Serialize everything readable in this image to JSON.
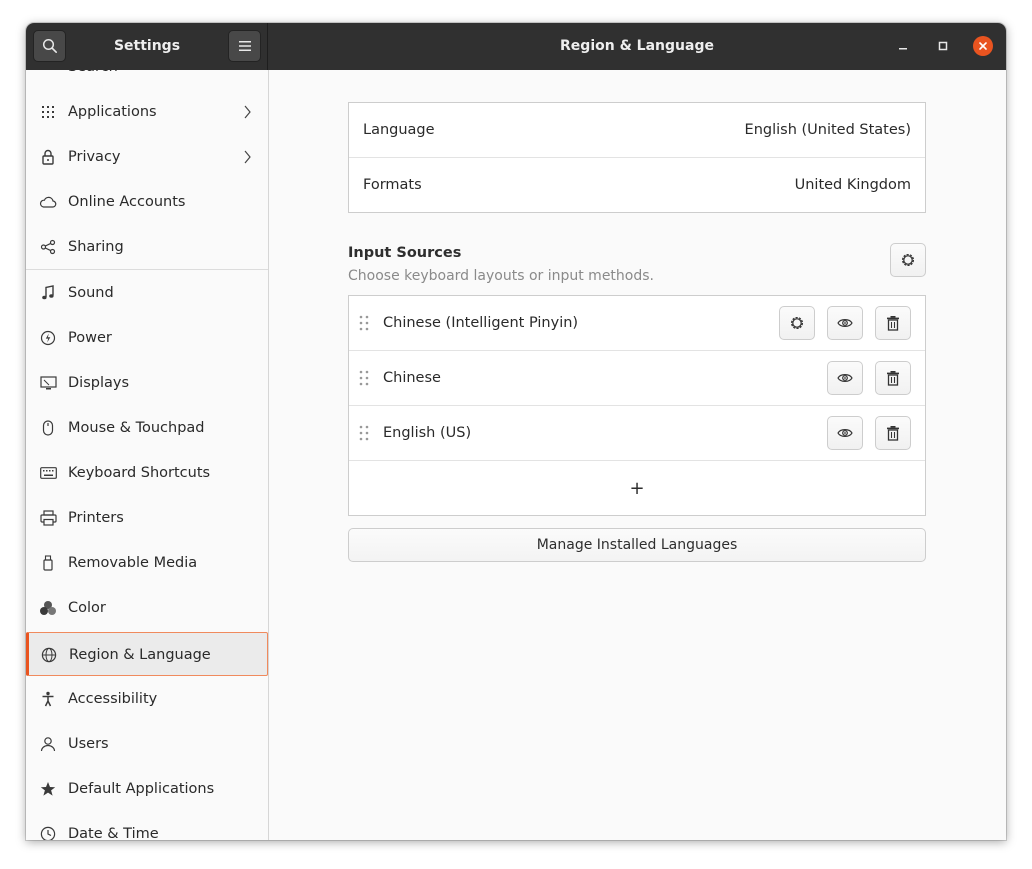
{
  "window": {
    "sidebar_title": "Settings",
    "page_title": "Region & Language"
  },
  "sidebar": {
    "partial_top_label": "Search",
    "items": [
      {
        "label": "Applications",
        "icon": "apps-grid-icon",
        "chevron": true
      },
      {
        "label": "Privacy",
        "icon": "lock-icon",
        "chevron": true
      },
      {
        "label": "Online Accounts",
        "icon": "cloud-icon",
        "chevron": false
      },
      {
        "label": "Sharing",
        "icon": "share-icon",
        "chevron": false
      },
      {
        "label": "Sound",
        "icon": "music-note-icon",
        "chevron": false
      },
      {
        "label": "Power",
        "icon": "power-icon",
        "chevron": false
      },
      {
        "label": "Displays",
        "icon": "display-icon",
        "chevron": false
      },
      {
        "label": "Mouse & Touchpad",
        "icon": "mouse-icon",
        "chevron": false
      },
      {
        "label": "Keyboard Shortcuts",
        "icon": "keyboard-icon",
        "chevron": false
      },
      {
        "label": "Printers",
        "icon": "printer-icon",
        "chevron": false
      },
      {
        "label": "Removable Media",
        "icon": "usb-drive-icon",
        "chevron": false
      },
      {
        "label": "Color",
        "icon": "color-circles-icon",
        "chevron": false
      },
      {
        "label": "Region & Language",
        "icon": "globe-icon",
        "chevron": false,
        "selected": true
      },
      {
        "label": "Accessibility",
        "icon": "accessibility-icon",
        "chevron": false
      },
      {
        "label": "Users",
        "icon": "user-icon",
        "chevron": false
      },
      {
        "label": "Default Applications",
        "icon": "star-icon",
        "chevron": false
      },
      {
        "label": "Date & Time",
        "icon": "clock-icon",
        "chevron": false
      }
    ]
  },
  "region": {
    "language_label": "Language",
    "language_value": "English (United States)",
    "formats_label": "Formats",
    "formats_value": "United Kingdom"
  },
  "input_sources": {
    "title": "Input Sources",
    "subtitle": "Choose keyboard layouts or input methods.",
    "sources": [
      {
        "label": "Chinese (Intelligent Pinyin)",
        "has_settings": true
      },
      {
        "label": "Chinese",
        "has_settings": false
      },
      {
        "label": "English (US)",
        "has_settings": false
      }
    ],
    "add_symbol": "+"
  },
  "manage_button_label": "Manage Installed Languages",
  "colors": {
    "accent": "#e95420",
    "headerbar": "#303030",
    "selected_bg": "#ebebeb"
  }
}
